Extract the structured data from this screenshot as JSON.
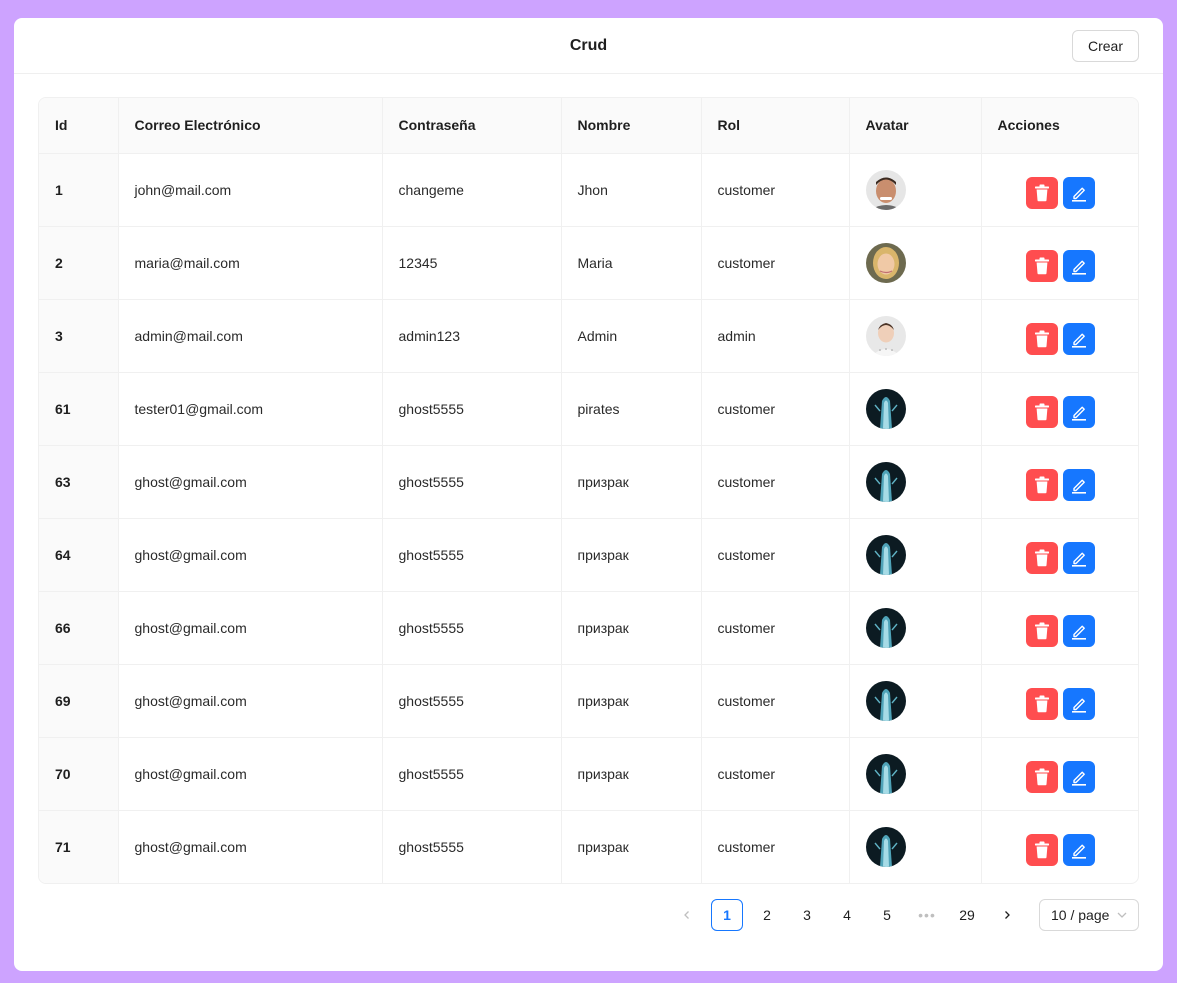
{
  "header": {
    "title": "Crud",
    "create_label": "Crear"
  },
  "table": {
    "columns": [
      "Id",
      "Correo Electrónico",
      "Contraseña",
      "Nombre",
      "Rol",
      "Avatar",
      "Acciones"
    ],
    "rows": [
      {
        "id": "1",
        "email": "john@mail.com",
        "password": "changeme",
        "name": "Jhon",
        "role": "customer",
        "avatar": "man-face"
      },
      {
        "id": "2",
        "email": "maria@mail.com",
        "password": "12345",
        "name": "Maria",
        "role": "customer",
        "avatar": "blonde-woman-face"
      },
      {
        "id": "3",
        "email": "admin@mail.com",
        "password": "admin123",
        "name": "Admin",
        "role": "admin",
        "avatar": "woman-face"
      },
      {
        "id": "61",
        "email": "tester01@gmail.com",
        "password": "ghost5555",
        "name": "pirates",
        "role": "customer",
        "avatar": "ghost-figure"
      },
      {
        "id": "63",
        "email": "ghost@gmail.com",
        "password": "ghost5555",
        "name": "призрак",
        "role": "customer",
        "avatar": "ghost-figure"
      },
      {
        "id": "64",
        "email": "ghost@gmail.com",
        "password": "ghost5555",
        "name": "призрак",
        "role": "customer",
        "avatar": "ghost-figure"
      },
      {
        "id": "66",
        "email": "ghost@gmail.com",
        "password": "ghost5555",
        "name": "призрак",
        "role": "customer",
        "avatar": "ghost-figure"
      },
      {
        "id": "69",
        "email": "ghost@gmail.com",
        "password": "ghost5555",
        "name": "призрак",
        "role": "customer",
        "avatar": "ghost-figure"
      },
      {
        "id": "70",
        "email": "ghost@gmail.com",
        "password": "ghost5555",
        "name": "призрак",
        "role": "customer",
        "avatar": "ghost-figure"
      },
      {
        "id": "71",
        "email": "ghost@gmail.com",
        "password": "ghost5555",
        "name": "призрак",
        "role": "customer",
        "avatar": "ghost-figure"
      }
    ]
  },
  "actions": {
    "delete_icon": "trash-icon",
    "edit_icon": "edit-icon"
  },
  "pagination": {
    "current": "1",
    "pages": [
      "1",
      "2",
      "3",
      "4",
      "5"
    ],
    "ellipsis": "•••",
    "last": "29",
    "page_size": "10 / page"
  },
  "colors": {
    "background": "#cda3ff",
    "delete": "#ff4d4f",
    "edit": "#1677ff",
    "active_page": "#1677ff"
  }
}
